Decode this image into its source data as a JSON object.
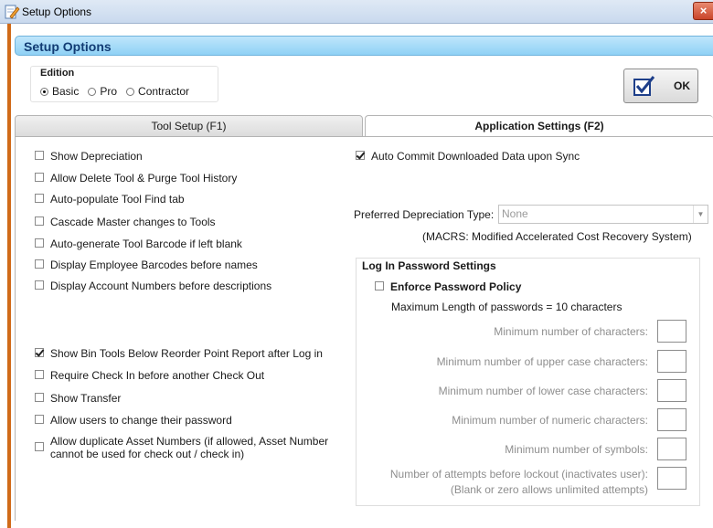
{
  "window": {
    "title": "Setup Options",
    "close_glyph": "×"
  },
  "header": {
    "title": "Setup Options"
  },
  "edition": {
    "legend": "Edition",
    "options": [
      {
        "label": "Basic",
        "selected": true
      },
      {
        "label": "Pro",
        "selected": false
      },
      {
        "label": "Contractor",
        "selected": false
      }
    ]
  },
  "ok_button": {
    "label": "OK"
  },
  "tabs": [
    {
      "label": "Tool Setup (F1)",
      "active": false
    },
    {
      "label": "Application Settings (F2)",
      "active": true
    }
  ],
  "left_options": [
    {
      "label": "Show Depreciation",
      "checked": false
    },
    {
      "label": "Allow Delete Tool & Purge Tool History",
      "checked": false
    },
    {
      "label": "Auto-populate Tool Find tab",
      "checked": false
    },
    {
      "label": "Cascade Master changes to Tools",
      "checked": false
    },
    {
      "label": "Auto-generate Tool Barcode if left blank",
      "checked": false
    },
    {
      "label": "Display Employee Barcodes before names",
      "checked": false
    },
    {
      "label": "Display Account Numbers before descriptions",
      "checked": false
    },
    {
      "label": "Show Bin Tools Below Reorder Point Report after Log in",
      "checked": true
    },
    {
      "label": "Require Check In before another Check Out",
      "checked": false
    },
    {
      "label": "Show Transfer",
      "checked": false
    },
    {
      "label": "Allow users to change their password",
      "checked": false
    },
    {
      "label": "Allow duplicate Asset Numbers (if allowed, Asset Number",
      "label2": "cannot be used for check out / check in)",
      "checked": false
    }
  ],
  "right_options": {
    "auto_commit": {
      "label": "Auto Commit Downloaded Data upon Sync",
      "checked": true
    },
    "depreciation": {
      "label": "Preferred Depreciation Type:",
      "value": "None",
      "note": "(MACRS:  Modified Accelerated Cost Recovery System)"
    }
  },
  "password_settings": {
    "legend": "Log In Password Settings",
    "enforce": {
      "label": "Enforce Password Policy",
      "checked": false
    },
    "max_length_text": "Maximum Length of passwords = 10 characters",
    "fields": [
      {
        "label": "Minimum number of characters:"
      },
      {
        "label": "Minimum number of upper case characters:"
      },
      {
        "label": "Minimum number of lower case characters:"
      },
      {
        "label": "Minimum number of numeric characters:"
      },
      {
        "label": "Minimum number of symbols:"
      },
      {
        "label": "Number of attempts before lockout (inactivates user):",
        "label2": "(Blank or zero allows unlimited attempts)"
      }
    ]
  }
}
